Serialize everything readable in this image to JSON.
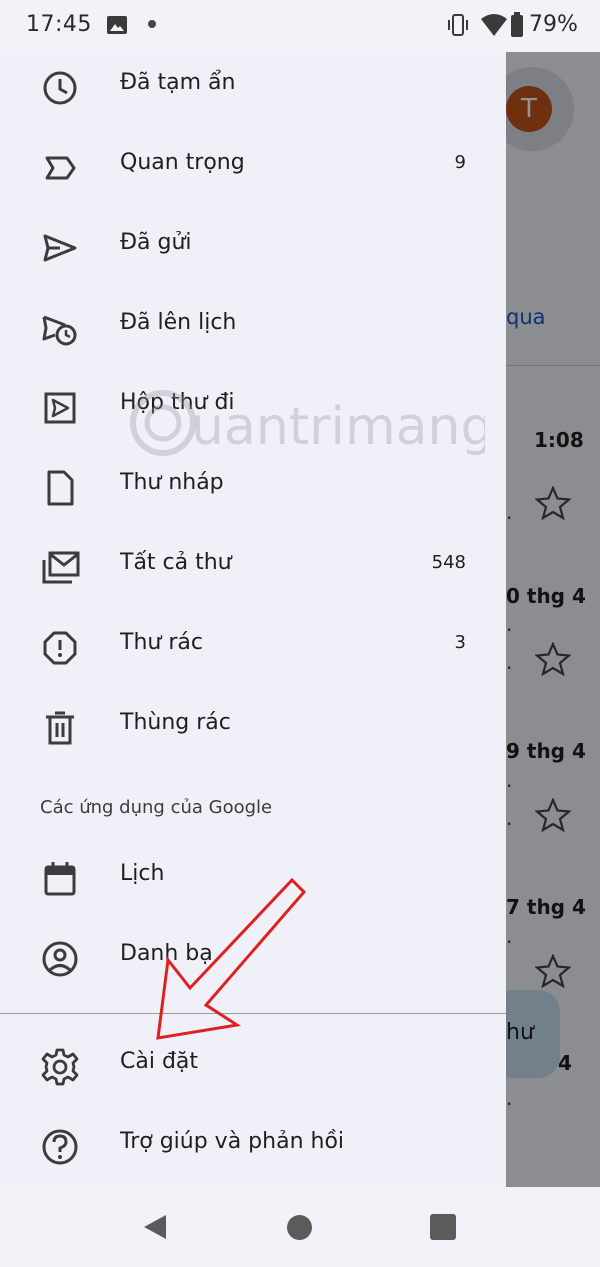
{
  "status_bar": {
    "time": "17:45",
    "battery_percent": "79%"
  },
  "background": {
    "avatar_initial": "T",
    "link_text": "qua",
    "emails": [
      {
        "time": "1:08"
      },
      {
        "date": "0 thg 4"
      },
      {
        "date": "9 thg 4"
      },
      {
        "date": "7 thg 4"
      },
      {
        "date": "4"
      }
    ],
    "compose_fab_text": "hư"
  },
  "drawer": {
    "items": [
      {
        "label": "Đã tạm ẩn",
        "icon": "clock-icon",
        "count": ""
      },
      {
        "label": "Quan trọng",
        "icon": "label-important-icon",
        "count": "9"
      },
      {
        "label": "Đã gửi",
        "icon": "send-icon",
        "count": ""
      },
      {
        "label": "Đã lên lịch",
        "icon": "schedule-send-icon",
        "count": ""
      },
      {
        "label": "Hộp thư đi",
        "icon": "outbox-icon",
        "count": ""
      },
      {
        "label": "Thư nháp",
        "icon": "draft-icon",
        "count": ""
      },
      {
        "label": "Tất cả thư",
        "icon": "all-mail-icon",
        "count": "548"
      },
      {
        "label": "Thư rác",
        "icon": "spam-icon",
        "count": "3"
      },
      {
        "label": "Thùng rác",
        "icon": "trash-icon",
        "count": ""
      }
    ],
    "google_apps_header": "Các ứng dụng của Google",
    "google_apps": [
      {
        "label": "Lịch",
        "icon": "calendar-icon"
      },
      {
        "label": "Danh bạ",
        "icon": "contacts-icon"
      }
    ],
    "footer_items": [
      {
        "label": "Cài đặt",
        "icon": "settings-gear-icon"
      },
      {
        "label": "Trợ giúp và phản hồi",
        "icon": "help-icon"
      }
    ]
  },
  "watermark": {
    "text": "uantrimang"
  },
  "colors": {
    "drawer_bg": "#f0f1f8",
    "accent_blue": "#1a56c8",
    "annotation_red": "#e02020",
    "avatar_orange": "#c0531a"
  }
}
